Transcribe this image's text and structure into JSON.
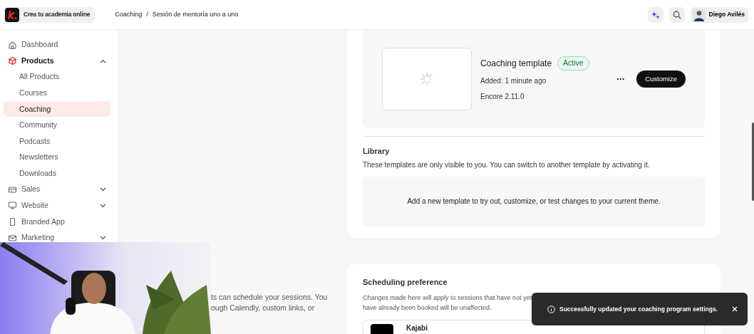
{
  "header": {
    "brand": "Crea tu academia online",
    "breadcrumbs": [
      "Coaching",
      "Sesión de mentoría uno a uno"
    ],
    "separator": "/",
    "user": "Diego Avilés"
  },
  "sidebar": {
    "items": [
      {
        "label": "Dashboard",
        "kind": "link",
        "selected": false
      },
      {
        "label": "Products",
        "kind": "group",
        "selected": true,
        "expanded": true,
        "children": [
          {
            "label": "All Products",
            "selected": false
          },
          {
            "label": "Courses",
            "selected": false
          },
          {
            "label": "Coaching",
            "selected": true
          },
          {
            "label": "Community",
            "selected": false
          },
          {
            "label": "Podcasts",
            "selected": false
          },
          {
            "label": "Newsletters",
            "selected": false
          },
          {
            "label": "Downloads",
            "selected": false
          }
        ]
      },
      {
        "label": "Sales",
        "kind": "group",
        "selected": false,
        "expanded": false
      },
      {
        "label": "Website",
        "kind": "group",
        "selected": false,
        "expanded": false
      },
      {
        "label": "Branded App",
        "kind": "link",
        "selected": false
      },
      {
        "label": "Marketing",
        "kind": "group",
        "selected": false,
        "expanded": false
      }
    ]
  },
  "template": {
    "title": "Coaching template",
    "status": "Active",
    "added": "Added: 1 minute ago",
    "version": "Encore 2.11.0",
    "more": "···",
    "action": "Customize"
  },
  "library": {
    "title": "Library",
    "description": "These templates are only visible to you. You can switch to another template by activating it.",
    "empty_message": "Add a new template to try out, customize, or test changes to your current theme."
  },
  "scheduling": {
    "intro_lines": [
      "ts can schedule your sessions. You",
      "ough Calendly, custom links, or"
    ],
    "title": "Scheduling preference",
    "description_lines": [
      "Changes made here will apply to sessions that have not yet",
      "have already been booked will be unaffected."
    ],
    "option": "Kajabi"
  },
  "toast": {
    "message": "Successfully updated your coaching program settings."
  }
}
